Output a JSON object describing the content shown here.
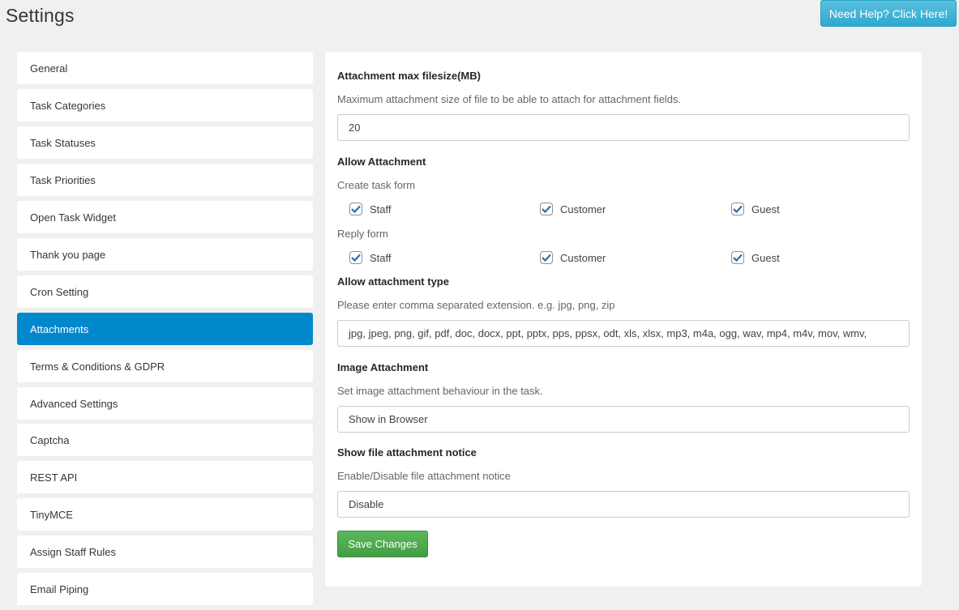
{
  "page": {
    "title": "Settings",
    "help_button": "Need Help? Click Here!"
  },
  "sidebar": {
    "active": "Attachments",
    "items": [
      {
        "label": "General"
      },
      {
        "label": "Task Categories"
      },
      {
        "label": "Task Statuses"
      },
      {
        "label": "Task Priorities"
      },
      {
        "label": "Open Task Widget"
      },
      {
        "label": "Thank you page"
      },
      {
        "label": "Cron Setting"
      },
      {
        "label": "Attachments"
      },
      {
        "label": "Terms & Conditions & GDPR"
      },
      {
        "label": "Advanced Settings"
      },
      {
        "label": "Captcha"
      },
      {
        "label": "REST API"
      },
      {
        "label": "TinyMCE"
      },
      {
        "label": "Assign Staff Rules"
      },
      {
        "label": "Email Piping"
      }
    ]
  },
  "form": {
    "max_filesize": {
      "title": "Attachment max filesize(MB)",
      "description": "Maximum attachment size of file to be able to attach for attachment fields.",
      "value": "20"
    },
    "allow_attachment": {
      "title": "Allow Attachment",
      "create_label": "Create task form",
      "reply_label": "Reply form",
      "create": [
        {
          "label": "Staff",
          "checked": true
        },
        {
          "label": "Customer",
          "checked": true
        },
        {
          "label": "Guest",
          "checked": true
        }
      ],
      "reply": [
        {
          "label": "Staff",
          "checked": true
        },
        {
          "label": "Customer",
          "checked": true
        },
        {
          "label": "Guest",
          "checked": true
        }
      ]
    },
    "attachment_type": {
      "title": "Allow attachment type",
      "description": "Please enter comma separated extension. e.g. jpg, png, zip",
      "value": "jpg, jpeg, png, gif, pdf, doc, docx, ppt, pptx, pps, ppsx, odt, xls, xlsx, mp3, m4a, ogg, wav, mp4, m4v, mov, wmv,"
    },
    "image_attachment": {
      "title": "Image Attachment",
      "description": "Set image attachment behaviour in the task.",
      "value": "Show in Browser"
    },
    "file_notice": {
      "title": "Show file attachment notice",
      "description": "Enable/Disable file attachment notice",
      "value": "Disable"
    },
    "save_label": "Save Changes"
  },
  "colors": {
    "accent": "#0088cc",
    "save": "#4cae4c",
    "help": "#5bc0de",
    "check": "#2271b1"
  }
}
